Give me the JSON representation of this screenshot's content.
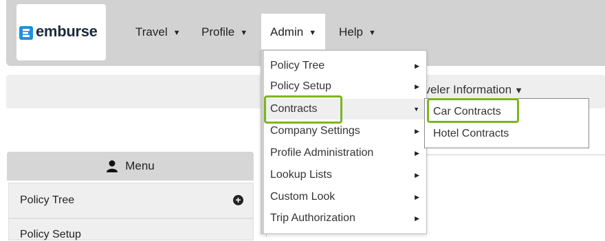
{
  "brand": {
    "name": "emburse"
  },
  "nav": {
    "travel": "Travel",
    "profile": "Profile",
    "admin": "Admin",
    "help": "Help"
  },
  "band": {
    "traveler_info": "aveler Information"
  },
  "side_menu": {
    "header": "Menu",
    "items": [
      "Policy Tree",
      "Policy Setup"
    ]
  },
  "admin_menu": {
    "items": [
      "Policy Tree",
      "Policy Setup",
      "Contracts",
      "Company Settings",
      "Profile Administration",
      "Lookup Lists",
      "Custom Look",
      "Trip Authorization"
    ]
  },
  "contracts_submenu": {
    "items": [
      "Car Contracts",
      "Hotel Contracts"
    ]
  },
  "colors": {
    "highlight": "#7ab51d",
    "brand": "#1e90e0"
  }
}
